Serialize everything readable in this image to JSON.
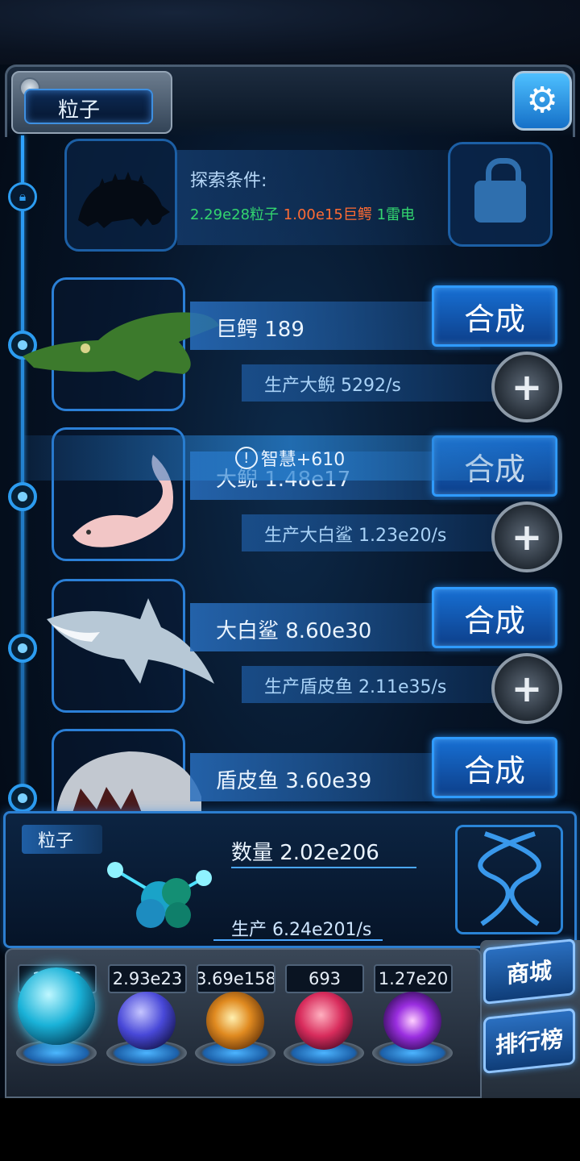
{
  "header": {
    "title": "粒子",
    "settings_icon": "gear-icon"
  },
  "explore": {
    "title": "探索条件:",
    "req_particles": "2.29e28粒子",
    "req_croc": "1.00e15巨鳄",
    "req_thunder": "1雷电",
    "lock_icon": "lock-icon"
  },
  "creatures": [
    {
      "name_line": "巨鳄 189",
      "produce_line": "生产大鲵 5292/s",
      "synth_label": "合成"
    },
    {
      "name_line": "大鲵 1.48e17",
      "produce_line": "生产大白鲨 1.23e20/s",
      "synth_label": "合成"
    },
    {
      "name_line": "大白鲨 8.60e30",
      "produce_line": "生产盾皮鱼 2.11e35/s",
      "synth_label": "合成"
    },
    {
      "name_line": "盾皮鱼 3.60e39",
      "synth_label": "合成"
    }
  ],
  "toast": {
    "text": "智慧+610",
    "icon": "!"
  },
  "resource": {
    "tag": "粒子",
    "count_line": "数量 2.02e206",
    "produce_line": "生产 6.24e201/s"
  },
  "tabs": [
    {
      "value": "2.02e206",
      "visible_value": "2…06",
      "name": "particles",
      "color": "#38e0ff"
    },
    {
      "value": "2.93e23",
      "name": "thunder",
      "color": "#6c6cff"
    },
    {
      "value": "3.69e158",
      "name": "galaxy",
      "color": "#f0a030"
    },
    {
      "value": "693",
      "name": "brain",
      "color": "#ff4070"
    },
    {
      "value": "1.27e20",
      "name": "vortex",
      "color": "#b040ff"
    }
  ],
  "side_buttons": {
    "shop": "商城",
    "ranking": "排行榜"
  },
  "colors": {
    "accent": "#2c9cf0",
    "req_green": "#33d56f",
    "req_orange": "#ff6b33"
  }
}
